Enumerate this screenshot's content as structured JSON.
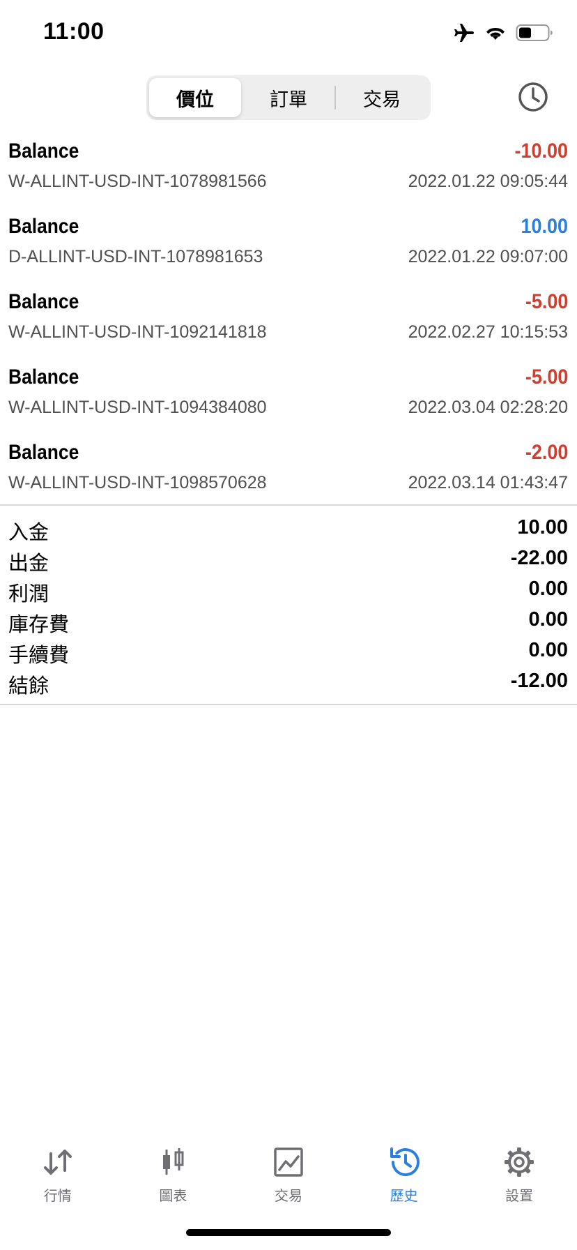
{
  "status_bar": {
    "time": "11:00"
  },
  "header": {
    "tabs": [
      {
        "label": "價位",
        "active": true
      },
      {
        "label": "訂單",
        "active": false
      },
      {
        "label": "交易",
        "active": false
      }
    ]
  },
  "records": [
    {
      "type": "Balance",
      "amount": "-10.00",
      "id": "W-ALLINT-USD-INT-1078981566",
      "date": "2022.01.22 09:05:44"
    },
    {
      "type": "Balance",
      "amount": "10.00",
      "id": "D-ALLINT-USD-INT-1078981653",
      "date": "2022.01.22 09:07:00"
    },
    {
      "type": "Balance",
      "amount": "-5.00",
      "id": "W-ALLINT-USD-INT-1092141818",
      "date": "2022.02.27 10:15:53"
    },
    {
      "type": "Balance",
      "amount": "-5.00",
      "id": "W-ALLINT-USD-INT-1094384080",
      "date": "2022.03.04 02:28:20"
    },
    {
      "type": "Balance",
      "amount": "-2.00",
      "id": "W-ALLINT-USD-INT-1098570628",
      "date": "2022.03.14 01:43:47"
    }
  ],
  "summary": [
    {
      "label": "入金",
      "value": "10.00"
    },
    {
      "label": "出金",
      "value": "-22.00"
    },
    {
      "label": "利潤",
      "value": "0.00"
    },
    {
      "label": "庫存費",
      "value": "0.00"
    },
    {
      "label": "手續費",
      "value": "0.00"
    },
    {
      "label": "結餘",
      "value": "-12.00"
    }
  ],
  "tab_bar": {
    "items": [
      {
        "label": "行情",
        "icon": "arrows-updown-icon",
        "active": false
      },
      {
        "label": "圖表",
        "icon": "candlestick-icon",
        "active": false
      },
      {
        "label": "交易",
        "icon": "trade-chart-icon",
        "active": false
      },
      {
        "label": "歷史",
        "icon": "history-icon",
        "active": true
      },
      {
        "label": "設置",
        "icon": "gear-icon",
        "active": false
      }
    ]
  },
  "colors": {
    "negative": "#cf3e2f",
    "positive": "#2a7fe0",
    "active_tab": "#2a7fe0",
    "inactive_tab": "#6f6f73"
  }
}
